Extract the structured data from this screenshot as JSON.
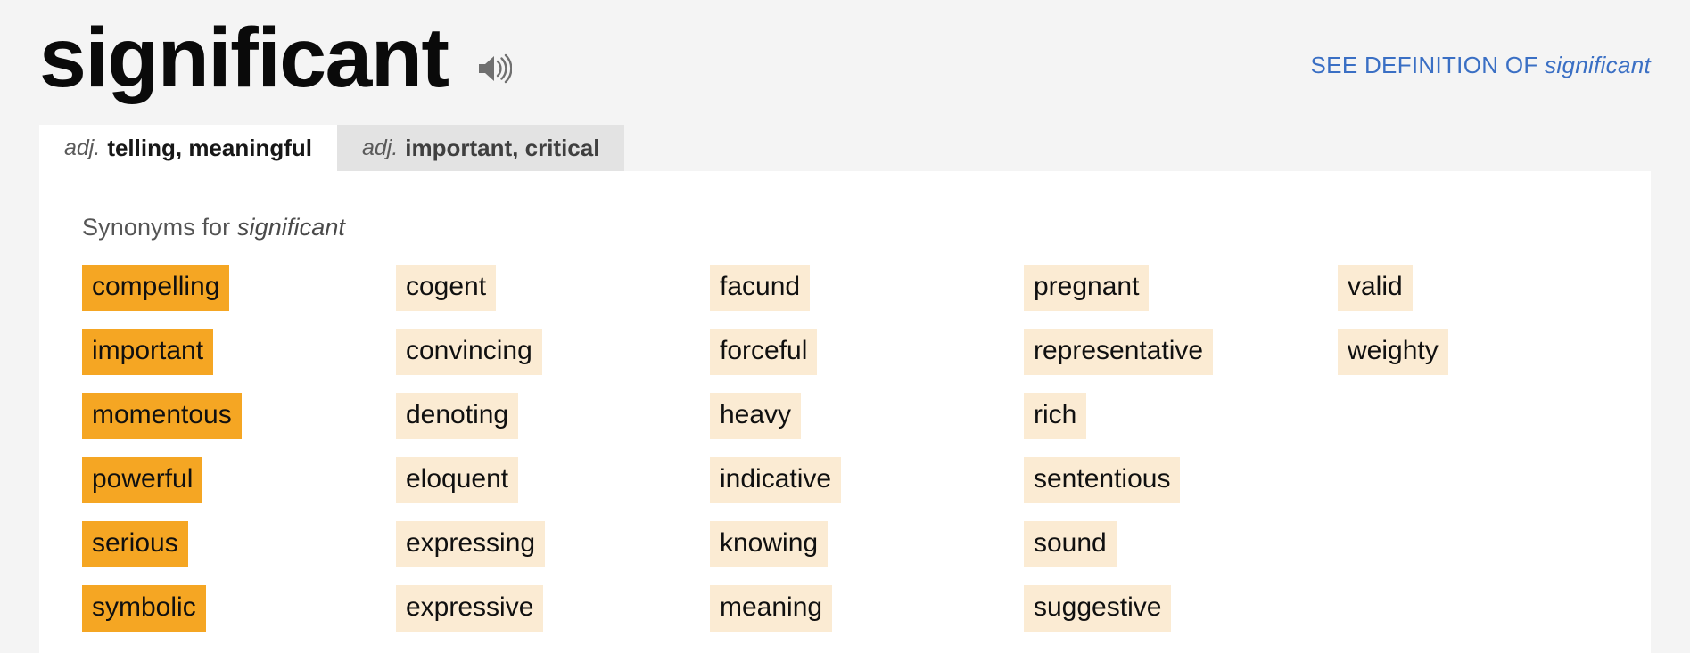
{
  "header": {
    "headword": "significant",
    "audio_icon": "speaker-icon",
    "see_definition_prefix": "SEE DEFINITION OF",
    "see_definition_word": "significant",
    "link_color": "#3a6fc4"
  },
  "tabs": [
    {
      "pos": "adj.",
      "label": "telling, meaningful",
      "active": true
    },
    {
      "pos": "adj.",
      "label": "important, critical",
      "active": false
    }
  ],
  "content": {
    "synonyms_label_prefix": "Synonyms for",
    "synonyms_label_word": "significant",
    "strength_colors": {
      "strongest": "#f5a623",
      "weak": "#fbebd3"
    },
    "columns": [
      {
        "strength": "strongest",
        "words": [
          "compelling",
          "important",
          "momentous",
          "powerful",
          "serious",
          "symbolic"
        ]
      },
      {
        "strength": "weak",
        "words": [
          "cogent",
          "convincing",
          "denoting",
          "eloquent",
          "expressing",
          "expressive"
        ]
      },
      {
        "strength": "weak",
        "words": [
          "facund",
          "forceful",
          "heavy",
          "indicative",
          "knowing",
          "meaning"
        ]
      },
      {
        "strength": "weak",
        "words": [
          "pregnant",
          "representative",
          "rich",
          "sententious",
          "sound",
          "suggestive"
        ]
      },
      {
        "strength": "weak",
        "words": [
          "valid",
          "weighty"
        ]
      }
    ]
  }
}
